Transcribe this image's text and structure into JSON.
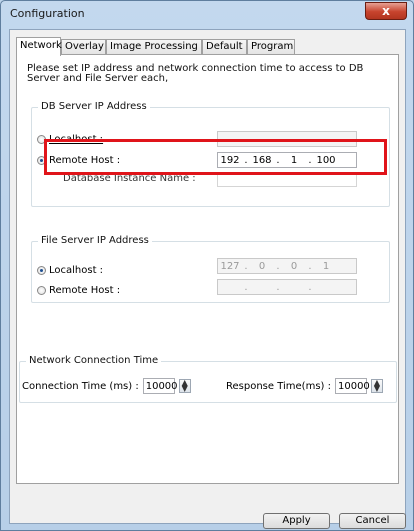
{
  "window": {
    "title": "Configuration",
    "close_label": "x"
  },
  "tabs": [
    {
      "label": "Network",
      "active": true
    },
    {
      "label": "Overlay"
    },
    {
      "label": "Image Processing"
    },
    {
      "label": "Default"
    },
    {
      "label": "Program"
    }
  ],
  "intro_text": "Please set IP address and network connection time to access to DB Server and File Server each,",
  "db_server": {
    "group_title": "DB Server IP Address",
    "localhost": {
      "label": "Localhost :",
      "checked": false,
      "ip": [
        ".",
        ".",
        "."
      ]
    },
    "remote": {
      "label": "Remote Host :",
      "checked": true,
      "ip": [
        "192",
        "168",
        "1",
        "100"
      ]
    },
    "instance_label": "Database Instance Name :",
    "instance_value": ""
  },
  "file_server": {
    "group_title": "File Server IP Address",
    "localhost": {
      "label": "Localhost :",
      "checked": true,
      "ip": [
        "127",
        "0",
        "0",
        "1"
      ]
    },
    "remote": {
      "label": "Remote Host :",
      "checked": false
    }
  },
  "network_time": {
    "group_title": "Network Connection Time",
    "connection_label": "Connection Time (ms) :",
    "connection_value": "10000",
    "response_label": "Response Time(ms) :",
    "response_value": "10000"
  },
  "buttons": {
    "apply": "Apply",
    "cancel": "Cancel"
  },
  "colors": {
    "highlight": "#e0141a",
    "title_bar": "#c3d8ee",
    "close_button": "#c7432d"
  }
}
